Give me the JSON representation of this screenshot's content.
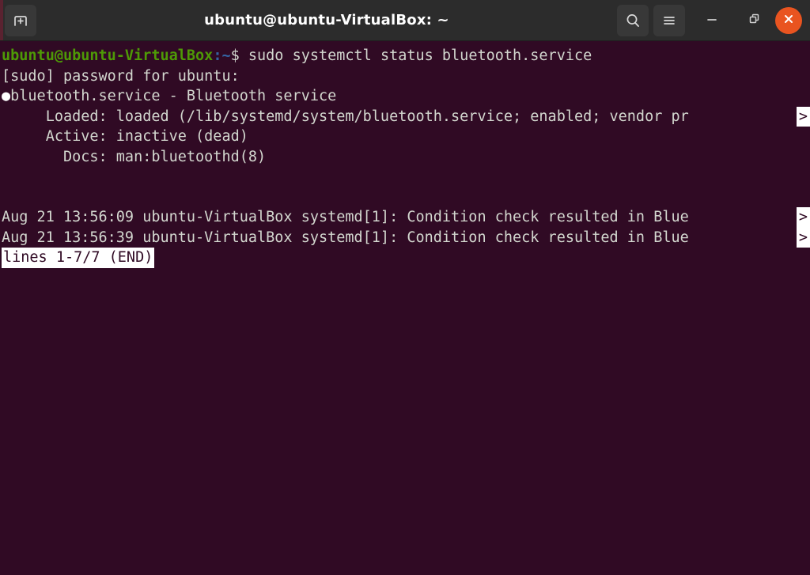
{
  "window": {
    "title": "ubuntu@ubuntu-VirtualBox: ~"
  },
  "titlebar": {
    "new_tab_icon": "new-tab-icon",
    "search_icon": "search-icon",
    "menu_icon": "hamburger-menu-icon",
    "minimize_icon": "minimize-icon",
    "maximize_icon": "maximize-restore-icon",
    "close_icon": "close-icon",
    "accent_color": "#e95420",
    "background_color": "#2c2c2c"
  },
  "terminal": {
    "background_color": "#300a24",
    "foreground_color": "#d3d7cf",
    "prompt": {
      "user_host": "ubuntu@ubuntu-VirtualBox",
      "user_host_color": "#4e9a06",
      "path": ":~",
      "path_color": "#3465a4",
      "sigil": "$ ",
      "command": "sudo systemctl status bluetooth.service"
    },
    "lines": {
      "sudo_prompt": "[sudo] password for ubuntu:",
      "unit_bullet": "●",
      "unit_header": "bluetooth.service - Bluetooth service",
      "loaded": "     Loaded: loaded (/lib/systemd/system/bluetooth.service; enabled; vendor pr",
      "active": "     Active: inactive (dead)",
      "docs": "       Docs: man:bluetoothd(8)",
      "log1": "Aug 21 13:56:09 ubuntu-VirtualBox systemd[1]: Condition check resulted in Blue",
      "log2": "Aug 21 13:56:39 ubuntu-VirtualBox systemd[1]: Condition check resulted in Blue",
      "truncation_marker": ">",
      "status_line": "lines 1-7/7 (END)"
    }
  }
}
